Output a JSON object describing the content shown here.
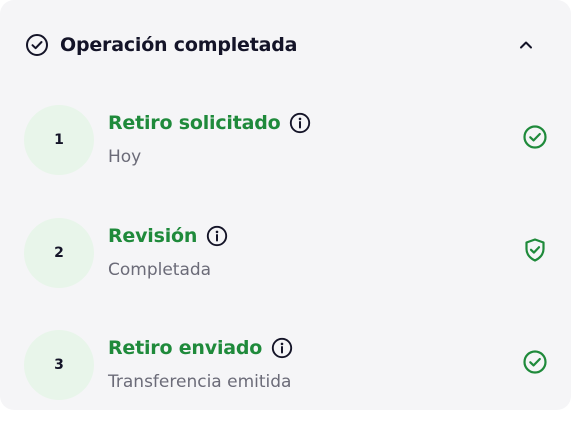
{
  "header": {
    "title": "Operación completada",
    "icon": "check-circle-icon",
    "toggle_icon": "chevron-up-icon"
  },
  "colors": {
    "accent": "#1f8a3b",
    "circle_bg": "#e8f5ea",
    "card_bg": "#f5f5f7",
    "text_dark": "#141428",
    "text_muted": "#6b6b78"
  },
  "steps": [
    {
      "number": "1",
      "title": "Retiro solicitado",
      "subtitle": "Hoy",
      "status_icon": "check-circle-icon"
    },
    {
      "number": "2",
      "title": "Revisión",
      "subtitle": "Completada",
      "status_icon": "shield-check-icon"
    },
    {
      "number": "3",
      "title": "Retiro enviado",
      "subtitle": "Transferencia emitida",
      "status_icon": "check-circle-icon"
    }
  ]
}
